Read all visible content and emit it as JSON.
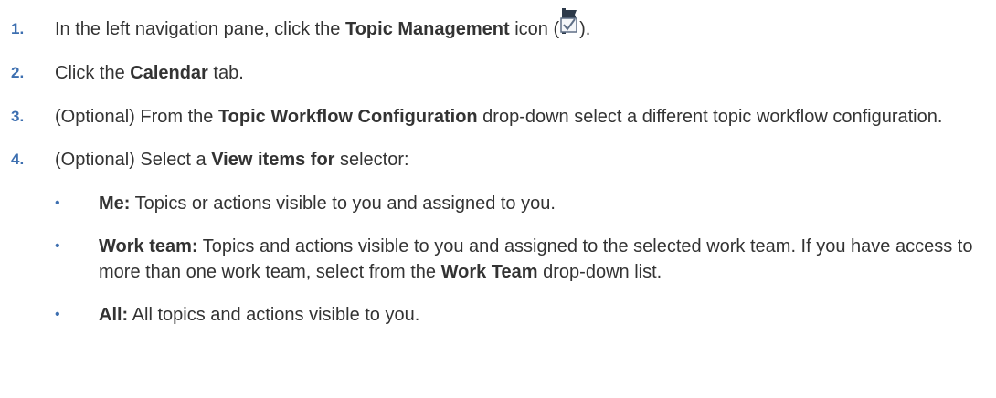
{
  "steps": [
    {
      "number": "1.",
      "before": "In the left navigation pane, click the ",
      "bold": "Topic Management",
      "mid": " icon (",
      "after": ").",
      "icon": "topic-management-icon"
    },
    {
      "number": "2.",
      "before": "Click the ",
      "bold": "Calendar",
      "after": " tab."
    },
    {
      "number": "3.",
      "before": "(Optional) From the ",
      "bold": "Topic Workflow Configuration",
      "after": " drop-down select a different topic workflow configuration."
    },
    {
      "number": "4.",
      "before": "(Optional) Select a ",
      "bold": "View items for",
      "after": " selector:"
    }
  ],
  "bullets": [
    {
      "marker": "•",
      "bold": "Me:",
      "text": " Topics or actions visible to you and assigned to you."
    },
    {
      "marker": "•",
      "bold": "Work team:",
      "text": " Topics and actions visible to you and assigned to the selected work team. If you have access to more than one work team, select from the ",
      "bold2": "Work Team",
      "text2": " drop-down list."
    },
    {
      "marker": "•",
      "bold": "All:",
      "text": " All topics and actions visible to you."
    }
  ]
}
